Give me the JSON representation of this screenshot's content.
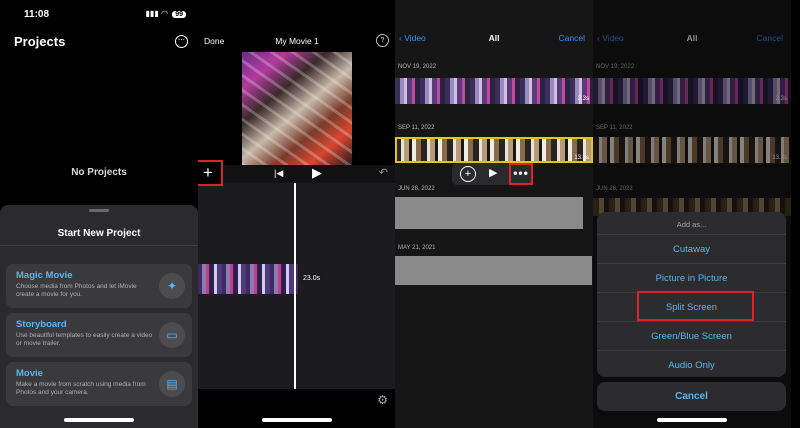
{
  "panel1": {
    "time": "11:08",
    "battery": "99",
    "title": "Projects",
    "more_icon": "ellipsis-circle-icon",
    "empty_text": "No Projects",
    "sheet_title": "Start New Project",
    "cards": [
      {
        "title": "Magic Movie",
        "desc": "Choose media from Photos and let iMovie create a movie for you.",
        "icon": "magic-wand-icon"
      },
      {
        "title": "Storyboard",
        "desc": "Use beautiful templates to easily create a video or movie trailer.",
        "icon": "storyboard-icon"
      },
      {
        "title": "Movie",
        "desc": "Make a movie from scratch using media from Photos and your camera.",
        "icon": "film-icon"
      }
    ]
  },
  "panel2": {
    "done": "Done",
    "title": "My Movie 1",
    "help": "?",
    "add": "+",
    "clip_duration": "23.0s"
  },
  "panel3": {
    "back": "Video",
    "title": "All",
    "cancel": "Cancel",
    "dates": [
      "NOV 19, 2022",
      "SEP 11, 2022",
      "JUN 28, 2022",
      "MAY 21, 2021"
    ],
    "durations": [
      "2.3s",
      "13.3s"
    ],
    "more": "•••"
  },
  "panel4": {
    "back": "Video",
    "title": "All",
    "cancel": "Cancel",
    "dates": [
      "NOV 19, 2022",
      "SEP 11, 2022",
      "JUN 28, 2022"
    ],
    "durations": [
      "2.3s",
      "13.3s"
    ],
    "add_as_title": "Add as...",
    "options": [
      "Cutaway",
      "Picture in Picture",
      "Split Screen",
      "Green/Blue Screen",
      "Audio Only"
    ],
    "cancel_button": "Cancel"
  },
  "colors": {
    "accent_blue": "#3a8ff0",
    "highlight_red": "#e0202a",
    "selection_yellow": "#e8c020"
  }
}
